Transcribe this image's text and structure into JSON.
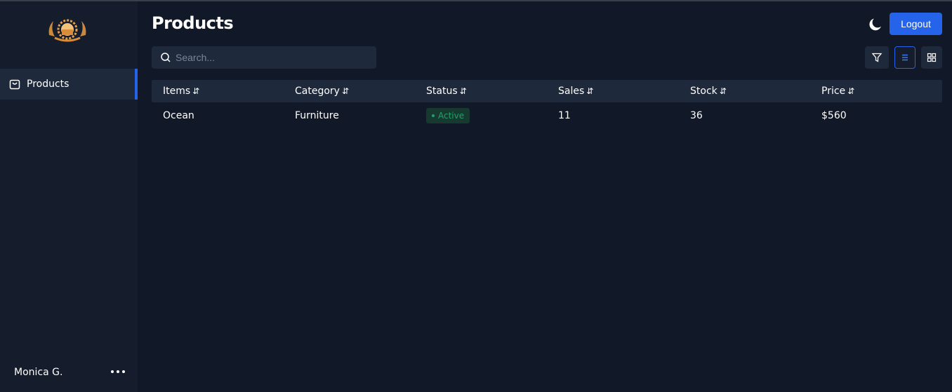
{
  "page": {
    "title": "Products"
  },
  "sidebar": {
    "items": [
      {
        "label": "Products",
        "icon": "shopping-bag-icon",
        "active": true
      }
    ],
    "user": {
      "name": "Monica G."
    }
  },
  "header": {
    "logout_label": "Logout",
    "theme_icon": "moon-icon"
  },
  "search": {
    "placeholder": "Search...",
    "value": ""
  },
  "toolbar": {
    "filter_icon": "filter-icon",
    "list_icon": "list-view-icon",
    "grid_icon": "grid-view-icon",
    "active_view": "list"
  },
  "table": {
    "columns": [
      "Items",
      "Category",
      "Status",
      "Sales",
      "Stock",
      "Price"
    ],
    "rows": [
      {
        "item": "Ocean",
        "category": "Furniture",
        "status": "Active",
        "sales": "11",
        "stock": "36",
        "price": "$560"
      }
    ]
  },
  "colors": {
    "accent": "#2563eb",
    "background": "#111827",
    "sidebar": "#151c2b",
    "surface": "#1e293b",
    "status_active": "#22a06b"
  }
}
